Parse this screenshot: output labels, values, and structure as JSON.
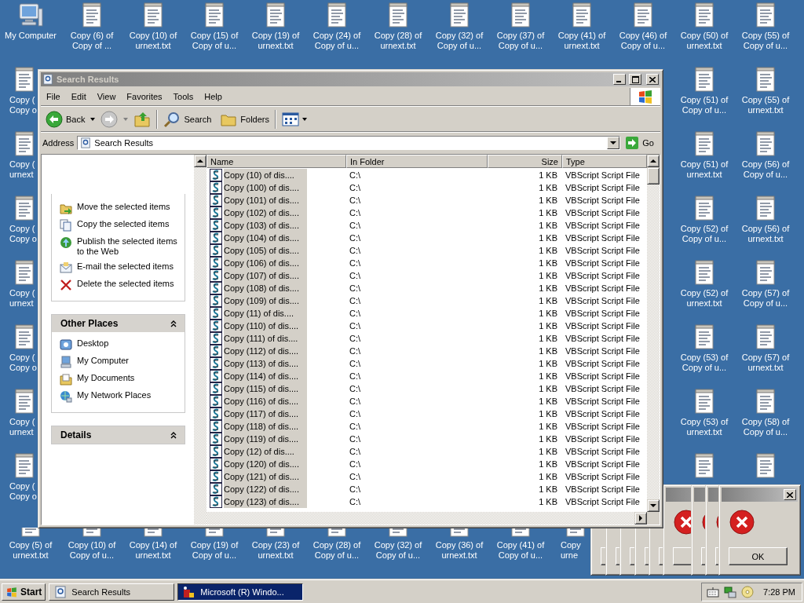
{
  "desktop": {
    "top_row": [
      {
        "kind": "computer",
        "lines": [
          "My Computer"
        ]
      },
      {
        "kind": "text_file",
        "lines": [
          "Copy (6) of",
          "Copy of ..."
        ]
      },
      {
        "kind": "text_file",
        "lines": [
          "Copy (10) of",
          "urnext.txt"
        ]
      },
      {
        "kind": "text_file",
        "lines": [
          "Copy (15) of",
          "Copy of u..."
        ]
      },
      {
        "kind": "text_file",
        "lines": [
          "Copy (19) of",
          "urnext.txt"
        ]
      },
      {
        "kind": "text_file",
        "lines": [
          "Copy (24) of",
          "Copy of u..."
        ]
      },
      {
        "kind": "text_file",
        "lines": [
          "Copy (28) of",
          "urnext.txt"
        ]
      },
      {
        "kind": "text_file",
        "lines": [
          "Copy (32) of",
          "Copy of u..."
        ]
      },
      {
        "kind": "text_file",
        "lines": [
          "Copy (37) of",
          "Copy of u..."
        ]
      },
      {
        "kind": "text_file",
        "lines": [
          "Copy (41) of",
          "urnext.txt"
        ]
      },
      {
        "kind": "text_file",
        "lines": [
          "Copy (46) of",
          "Copy of u..."
        ]
      },
      {
        "kind": "text_file",
        "lines": [
          "Copy (50) of",
          "urnext.txt"
        ]
      },
      {
        "kind": "text_file",
        "lines": [
          "Copy (55) of",
          "Copy of u..."
        ]
      }
    ],
    "left_column": [
      {
        "kind": "text_file",
        "cut": true,
        "lines": [
          "Copy (",
          "Copy o"
        ]
      },
      {
        "kind": "text_file",
        "cut": true,
        "lines": [
          "Copy (",
          "urnext"
        ]
      },
      {
        "kind": "text_file",
        "cut": true,
        "lines": [
          "Copy (",
          "Copy o"
        ]
      },
      {
        "kind": "text_file",
        "cut": true,
        "lines": [
          "Copy (",
          "urnext"
        ]
      },
      {
        "kind": "text_file",
        "cut": true,
        "lines": [
          "Copy (",
          "Copy o"
        ]
      },
      {
        "kind": "text_file",
        "cut": true,
        "lines": [
          "Copy (",
          "urnext"
        ]
      },
      {
        "kind": "text_file",
        "cut": true,
        "lines": [
          "Copy (",
          "Copy o"
        ]
      }
    ],
    "right_columns": [
      [
        {
          "kind": "text_file",
          "lines": [
            "Copy (51) of",
            "Copy of u..."
          ]
        },
        {
          "kind": "text_file",
          "lines": [
            "Copy (51) of",
            "urnext.txt"
          ]
        },
        {
          "kind": "text_file",
          "lines": [
            "Copy (52) of",
            "Copy of u..."
          ]
        },
        {
          "kind": "text_file",
          "lines": [
            "Copy (52) of",
            "urnext.txt"
          ]
        },
        {
          "kind": "text_file",
          "lines": [
            "Copy (53) of",
            "Copy of u..."
          ]
        },
        {
          "kind": "text_file",
          "lines": [
            "Copy (53) of",
            "urnext.txt"
          ]
        },
        {
          "kind": "text_file"
        }
      ],
      [
        {
          "kind": "text_file",
          "lines": [
            "Copy (55) of",
            "urnext.txt"
          ]
        },
        {
          "kind": "text_file",
          "lines": [
            "Copy (56) of",
            "Copy of u..."
          ]
        },
        {
          "kind": "text_file",
          "lines": [
            "Copy (56) of",
            "urnext.txt"
          ]
        },
        {
          "kind": "text_file",
          "lines": [
            "Copy (57) of",
            "Copy of u..."
          ]
        },
        {
          "kind": "text_file",
          "lines": [
            "Copy (57) of",
            "urnext.txt"
          ]
        },
        {
          "kind": "text_file",
          "lines": [
            "Copy (58) of",
            "Copy of u..."
          ]
        },
        {
          "kind": "text_file"
        }
      ]
    ],
    "bottom_row": [
      {
        "kind": "text_file",
        "lines": [
          "Copy (5) of",
          "urnext.txt"
        ]
      },
      {
        "kind": "text_file",
        "lines": [
          "Copy (10) of",
          "Copy of u..."
        ]
      },
      {
        "kind": "text_file",
        "lines": [
          "Copy (14) of",
          "urnext.txt"
        ]
      },
      {
        "kind": "text_file",
        "lines": [
          "Copy (19) of",
          "Copy of u..."
        ]
      },
      {
        "kind": "text_file",
        "lines": [
          "Copy (23) of",
          "urnext.txt"
        ]
      },
      {
        "kind": "text_file",
        "lines": [
          "Copy (28) of",
          "Copy of u..."
        ]
      },
      {
        "kind": "text_file",
        "lines": [
          "Copy (32) of",
          "Copy of u..."
        ]
      },
      {
        "kind": "text_file",
        "lines": [
          "Copy (36) of",
          "urnext.txt"
        ]
      },
      {
        "kind": "text_file",
        "lines": [
          "Copy (41) of",
          "Copy of u..."
        ]
      },
      {
        "kind": "text_file",
        "cut": true,
        "lines": [
          "Copy",
          "urne"
        ]
      }
    ]
  },
  "window": {
    "title": "Search Results",
    "active": false,
    "menu": [
      "File",
      "Edit",
      "View",
      "Favorites",
      "Tools",
      "Help"
    ],
    "toolbar": {
      "back": "Back",
      "search": "Search",
      "folders": "Folders"
    },
    "address": {
      "label": "Address",
      "value": "Search Results",
      "go": "Go"
    },
    "tasks": [
      {
        "kind": "move",
        "label": "Move the selected items"
      },
      {
        "kind": "copy",
        "label": "Copy the selected items"
      },
      {
        "kind": "publish",
        "label": "Publish the selected items to the Web"
      },
      {
        "kind": "email",
        "label": "E-mail the selected items"
      },
      {
        "kind": "delete",
        "label": "Delete the selected items"
      }
    ],
    "other_places": {
      "title": "Other Places",
      "items": [
        {
          "kind": "desktop",
          "label": "Desktop"
        },
        {
          "kind": "computer",
          "label": "My Computer"
        },
        {
          "kind": "documents",
          "label": "My Documents"
        },
        {
          "kind": "network",
          "label": "My Network Places"
        }
      ]
    },
    "details": {
      "title": "Details"
    },
    "columns": [
      "Name",
      "In Folder",
      "Size",
      "Type"
    ],
    "rows": [
      {
        "name": "Copy (10) of dis....",
        "folder": "C:\\",
        "size": "1 KB",
        "type": "VBScript Script File",
        "selected": true
      },
      {
        "name": "Copy (100) of dis....",
        "folder": "C:\\",
        "size": "1 KB",
        "type": "VBScript Script File",
        "selected": true
      },
      {
        "name": "Copy (101) of dis....",
        "folder": "C:\\",
        "size": "1 KB",
        "type": "VBScript Script File",
        "selected": true
      },
      {
        "name": "Copy (102) of dis....",
        "folder": "C:\\",
        "size": "1 KB",
        "type": "VBScript Script File",
        "selected": true
      },
      {
        "name": "Copy (103) of dis....",
        "folder": "C:\\",
        "size": "1 KB",
        "type": "VBScript Script File",
        "selected": true
      },
      {
        "name": "Copy (104) of dis....",
        "folder": "C:\\",
        "size": "1 KB",
        "type": "VBScript Script File",
        "selected": true
      },
      {
        "name": "Copy (105) of dis....",
        "folder": "C:\\",
        "size": "1 KB",
        "type": "VBScript Script File",
        "selected": true
      },
      {
        "name": "Copy (106) of dis....",
        "folder": "C:\\",
        "size": "1 KB",
        "type": "VBScript Script File",
        "selected": true
      },
      {
        "name": "Copy (107) of dis....",
        "folder": "C:\\",
        "size": "1 KB",
        "type": "VBScript Script File",
        "selected": true
      },
      {
        "name": "Copy (108) of dis....",
        "folder": "C:\\",
        "size": "1 KB",
        "type": "VBScript Script File",
        "selected": true
      },
      {
        "name": "Copy (109) of dis....",
        "folder": "C:\\",
        "size": "1 KB",
        "type": "VBScript Script File",
        "selected": true
      },
      {
        "name": "Copy (11) of dis....",
        "folder": "C:\\",
        "size": "1 KB",
        "type": "VBScript Script File",
        "selected": true
      },
      {
        "name": "Copy (110) of dis....",
        "folder": "C:\\",
        "size": "1 KB",
        "type": "VBScript Script File",
        "selected": true
      },
      {
        "name": "Copy (111) of dis....",
        "folder": "C:\\",
        "size": "1 KB",
        "type": "VBScript Script File",
        "selected": true
      },
      {
        "name": "Copy (112) of dis....",
        "folder": "C:\\",
        "size": "1 KB",
        "type": "VBScript Script File",
        "selected": true
      },
      {
        "name": "Copy (113) of dis....",
        "folder": "C:\\",
        "size": "1 KB",
        "type": "VBScript Script File",
        "selected": true
      },
      {
        "name": "Copy (114) of dis....",
        "folder": "C:\\",
        "size": "1 KB",
        "type": "VBScript Script File",
        "selected": true
      },
      {
        "name": "Copy (115) of dis....",
        "folder": "C:\\",
        "size": "1 KB",
        "type": "VBScript Script File",
        "selected": true
      },
      {
        "name": "Copy (116) of dis....",
        "folder": "C:\\",
        "size": "1 KB",
        "type": "VBScript Script File",
        "selected": true
      },
      {
        "name": "Copy (117) of dis....",
        "folder": "C:\\",
        "size": "1 KB",
        "type": "VBScript Script File",
        "selected": true
      },
      {
        "name": "Copy (118) of dis....",
        "folder": "C:\\",
        "size": "1 KB",
        "type": "VBScript Script File",
        "selected": true
      },
      {
        "name": "Copy (119) of dis....",
        "folder": "C:\\",
        "size": "1 KB",
        "type": "VBScript Script File",
        "selected": true
      },
      {
        "name": "Copy (12) of dis....",
        "folder": "C:\\",
        "size": "1 KB",
        "type": "VBScript Script File",
        "selected": true
      },
      {
        "name": "Copy (120) of dis....",
        "folder": "C:\\",
        "size": "1 KB",
        "type": "VBScript Script File",
        "selected": true
      },
      {
        "name": "Copy (121) of dis....",
        "folder": "C:\\",
        "size": "1 KB",
        "type": "VBScript Script File",
        "selected": true
      },
      {
        "name": "Copy (122) of dis....",
        "folder": "C:\\",
        "size": "1 KB",
        "type": "VBScript Script File",
        "selected": true
      },
      {
        "name": "Copy (123) of dis....",
        "folder": "C:\\",
        "size": "1 KB",
        "type": "VBScript Script File",
        "selected": true
      }
    ]
  },
  "dialogs": [
    {
      "kind": "error"
    },
    {
      "kind": "error"
    },
    {
      "kind": "error"
    },
    {
      "kind": "error"
    },
    {
      "kind": "error"
    },
    {
      "kind": "error"
    },
    {
      "kind": "error"
    },
    {
      "kind": "error"
    },
    {
      "kind": "error",
      "button": "OK"
    }
  ],
  "taskbar": {
    "start": "Start",
    "tasks": [
      {
        "kind": "explorer",
        "label": "Search Results",
        "selected": false
      },
      {
        "kind": "program",
        "label": "Microsoft (R) Windo...",
        "selected": true
      }
    ],
    "clock": "7:28 PM"
  }
}
